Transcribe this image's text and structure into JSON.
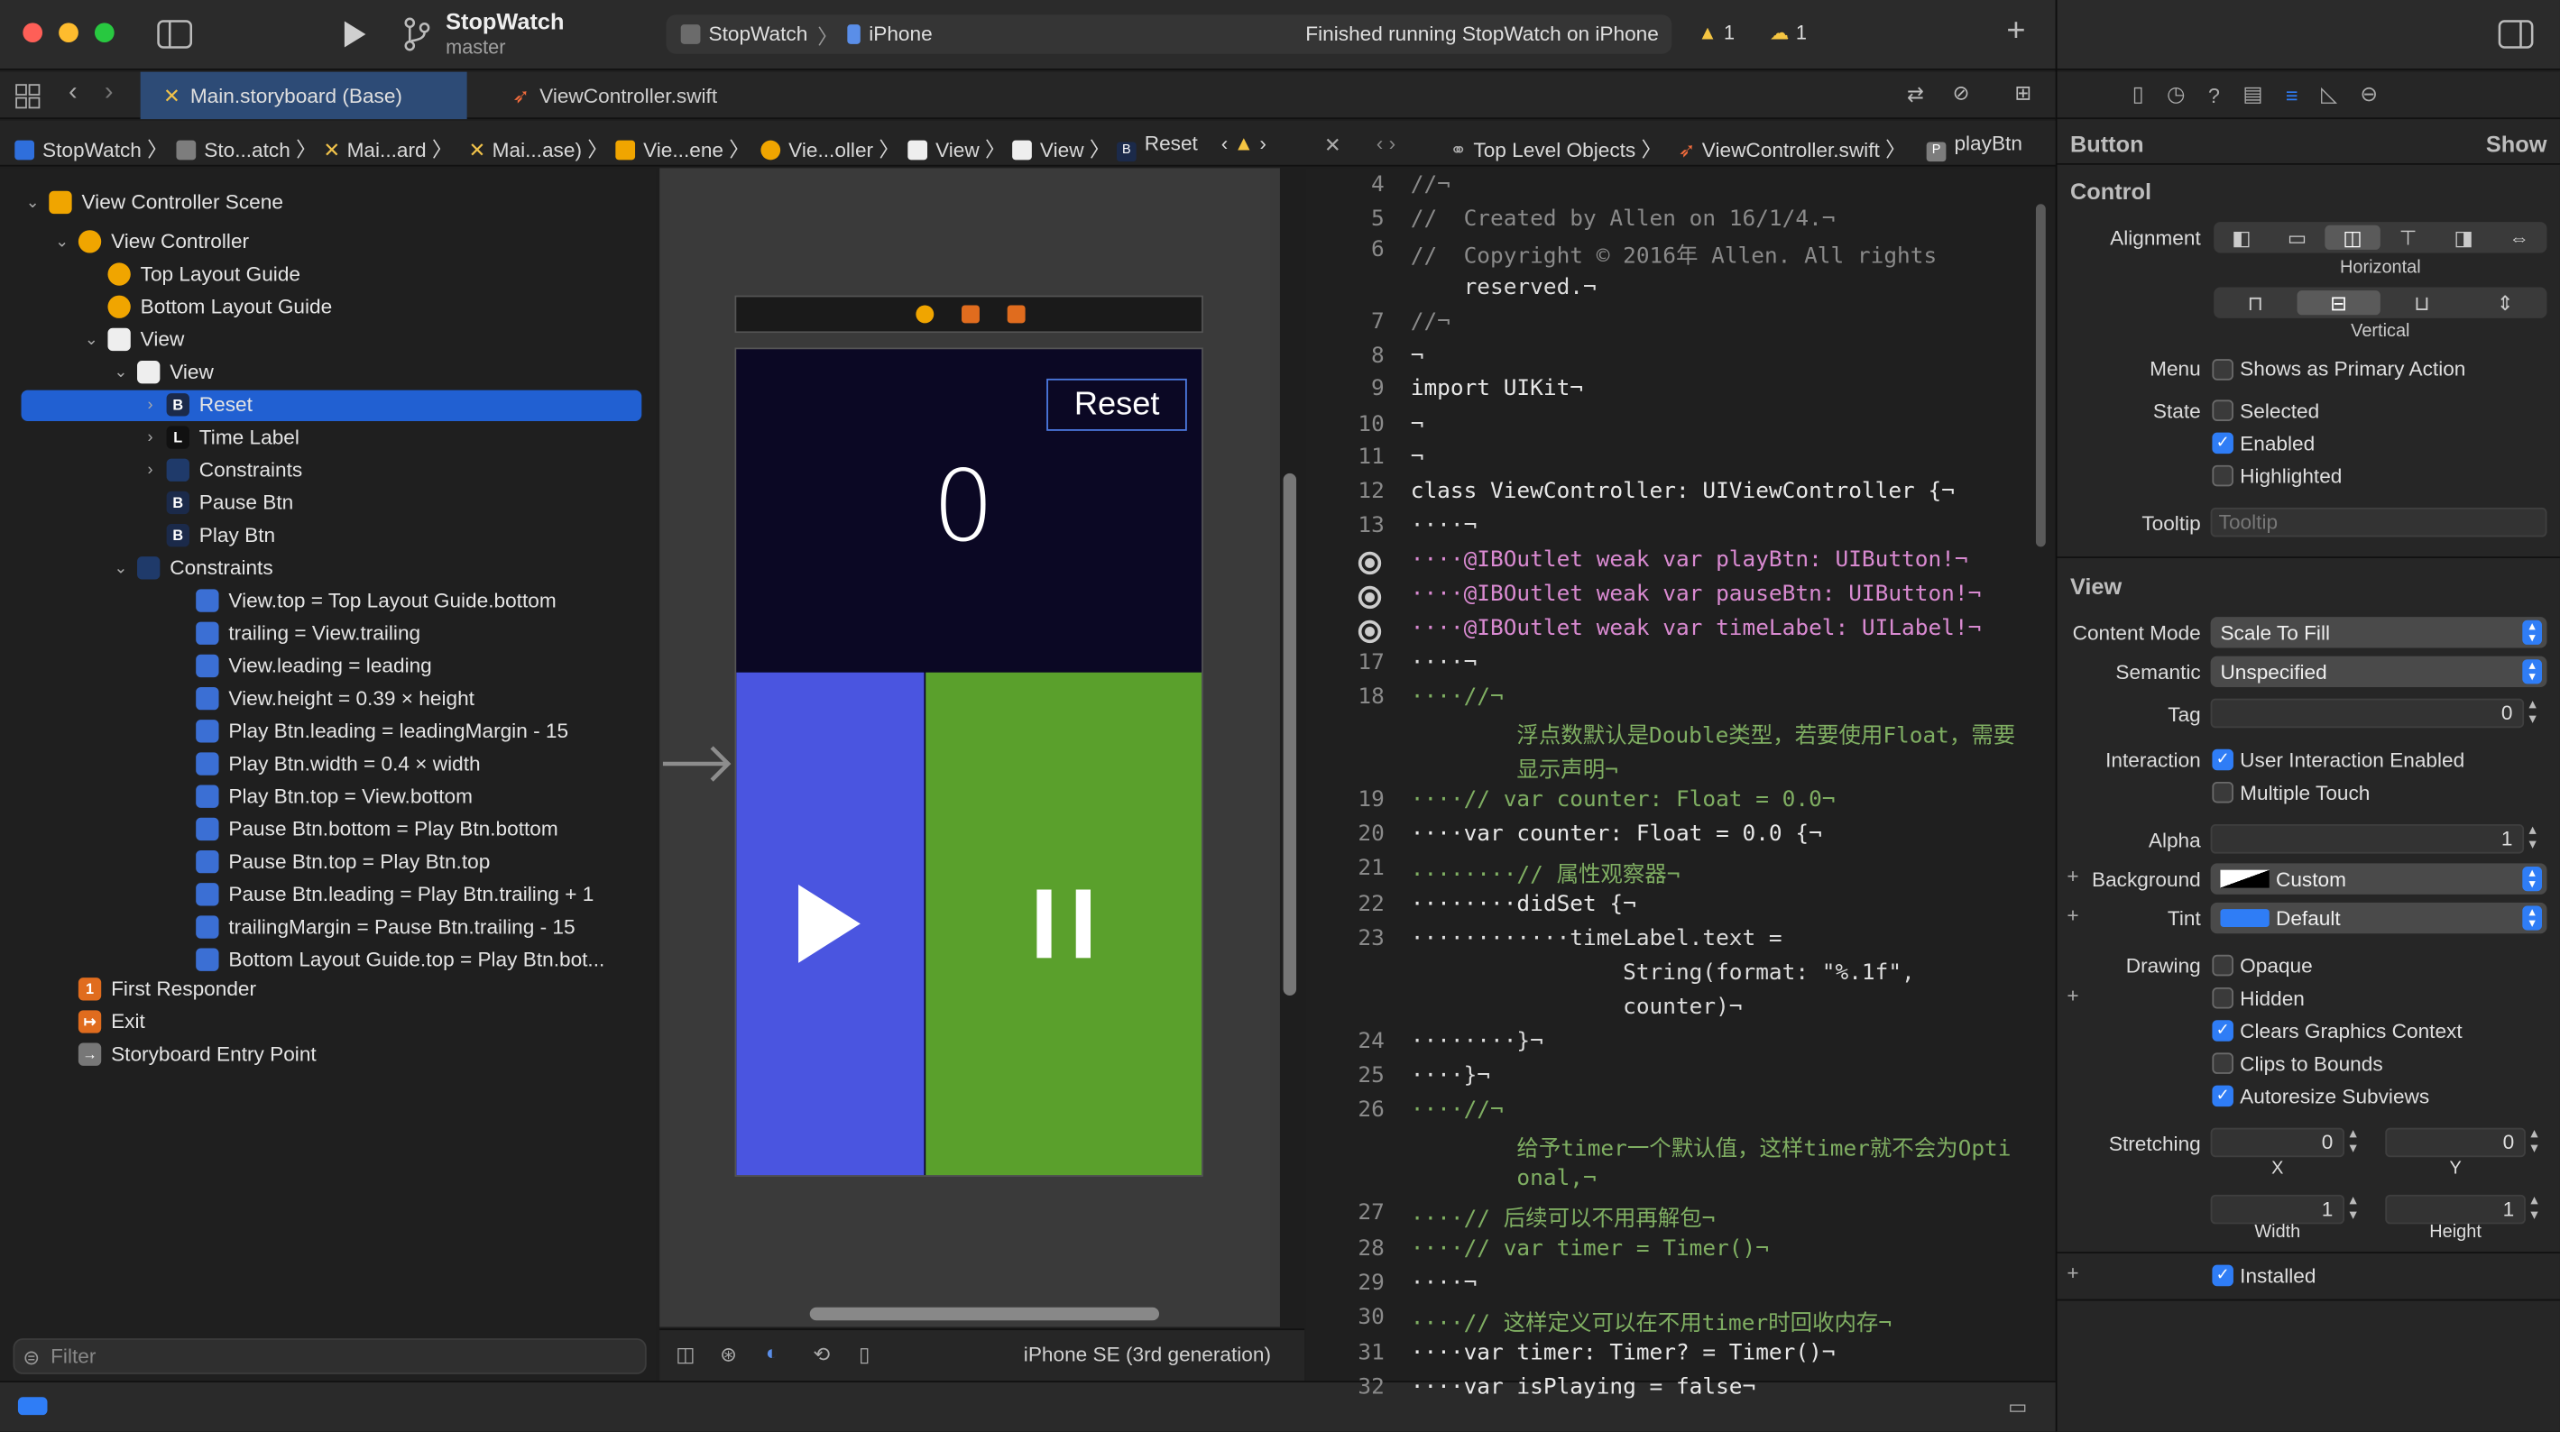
{
  "titlebar": {
    "project": "StopWatch",
    "branch": "master",
    "scheme": "StopWatch",
    "device": "iPhone",
    "status": "Finished running StopWatch on iPhone",
    "warnings": "1",
    "issues": "1"
  },
  "tabs": [
    {
      "label": "Main.storyboard (Base)"
    },
    {
      "label": "ViewController.swift"
    }
  ],
  "jumpbar": {
    "items": [
      "StopWatch",
      "Sto...atch",
      "Mai...ard",
      "Mai...ase)",
      "Vie...ene",
      "Vie...oller",
      "View",
      "View",
      "Reset"
    ],
    "right": [
      "Top Level Objects",
      "ViewController.swift",
      "playBtn"
    ]
  },
  "outline": {
    "items": [
      "View Controller Scene",
      "View Controller",
      "Top Layout Guide",
      "Bottom Layout Guide",
      "View",
      "View",
      "Reset",
      "Time Label",
      "Constraints",
      "Pause Btn",
      "Play Btn",
      "Constraints",
      "View.top = Top Layout Guide.bottom",
      "trailing = View.trailing",
      "View.leading = leading",
      "View.height = 0.39 × height",
      "Play Btn.leading = leadingMargin - 15",
      "Play Btn.width = 0.4 × width",
      "Play Btn.top = View.bottom",
      "Pause Btn.bottom = Play Btn.bottom",
      "Pause Btn.top = Play Btn.top",
      "Pause Btn.leading = Play Btn.trailing + 1",
      "trailingMargin = Pause Btn.trailing - 15",
      "Bottom Layout Guide.top = Play Btn.bot...",
      "First Responder",
      "Exit",
      "Storyboard Entry Point"
    ],
    "filter_placeholder": "Filter"
  },
  "canvas": {
    "reset_label": "Reset",
    "time_value": "0",
    "device_label": "iPhone SE (3rd generation)"
  },
  "code": {
    "lines": [
      {
        "n": "4",
        "t": "//¬"
      },
      {
        "n": "5",
        "t": "//  Created by Allen on 16/1/4.¬"
      },
      {
        "n": "6",
        "t": "//  Copyright © 2016年 Allen. All rights"
      },
      {
        "n": "",
        "t": "    reserved.¬"
      },
      {
        "n": "7",
        "t": "//¬"
      },
      {
        "n": "8",
        "t": "¬"
      },
      {
        "n": "9",
        "t": "import UIKit¬"
      },
      {
        "n": "10",
        "t": "¬"
      },
      {
        "n": "11",
        "t": "¬"
      },
      {
        "n": "12",
        "t": "class ViewController: UIViewController {¬"
      },
      {
        "n": "13",
        "t": "····¬"
      },
      {
        "n": "",
        "t": "····@IBOutlet weak var playBtn: UIButton!¬"
      },
      {
        "n": "",
        "t": "····@IBOutlet weak var pauseBtn: UIButton!¬"
      },
      {
        "n": "",
        "t": "····@IBOutlet weak var timeLabel: UILabel!¬"
      },
      {
        "n": "17",
        "t": "····¬"
      },
      {
        "n": "18",
        "t": "····//¬"
      },
      {
        "n": "",
        "t": "        浮点数默认是Double类型，若要使用Float，需要"
      },
      {
        "n": "",
        "t": "        显示声明¬"
      },
      {
        "n": "19",
        "t": "····// var counter: Float = 0.0¬"
      },
      {
        "n": "20",
        "t": "····var counter: Float = 0.0 {¬"
      },
      {
        "n": "21",
        "t": "········// 属性观察器¬"
      },
      {
        "n": "22",
        "t": "········didSet {¬"
      },
      {
        "n": "23",
        "t": "············timeLabel.text ="
      },
      {
        "n": "",
        "t": "                String(format: \"%.1f\","
      },
      {
        "n": "",
        "t": "                counter)¬"
      },
      {
        "n": "24",
        "t": "········}¬"
      },
      {
        "n": "25",
        "t": "····}¬"
      },
      {
        "n": "26",
        "t": "····//¬"
      },
      {
        "n": "",
        "t": "        给予timer一个默认值，这样timer就不会为Opti"
      },
      {
        "n": "",
        "t": "        onal,¬"
      },
      {
        "n": "27",
        "t": "····// 后续可以不用再解包¬"
      },
      {
        "n": "28",
        "t": "····// var timer = Timer()¬"
      },
      {
        "n": "29",
        "t": "····¬"
      },
      {
        "n": "30",
        "t": "····// 这样定义可以在不用timer时回收内存¬"
      },
      {
        "n": "31",
        "t": "····var timer: Timer? = Timer()¬"
      },
      {
        "n": "32",
        "t": "····var isPlaying = false¬"
      }
    ]
  },
  "inspector": {
    "title": "Button",
    "show": "Show",
    "control_hdr": "Control",
    "alignment": "Alignment",
    "horizontal": "Horizontal",
    "vertical": "Vertical",
    "menu": "Menu",
    "menu_opt": "Shows as Primary Action",
    "state": "State",
    "selected": "Selected",
    "enabled": "Enabled",
    "highlighted": "Highlighted",
    "tooltip": "Tooltip",
    "tooltip_ph": "Tooltip",
    "view_hdr": "View",
    "content_mode": "Content Mode",
    "content_mode_val": "Scale To Fill",
    "semantic": "Semantic",
    "semantic_val": "Unspecified",
    "tag": "Tag",
    "tag_val": "0",
    "interaction": "Interaction",
    "uie": "User Interaction Enabled",
    "mt": "Multiple Touch",
    "alpha": "Alpha",
    "alpha_val": "1",
    "background": "Background",
    "background_val": "Custom",
    "tint": "Tint",
    "tint_val": "Default",
    "drawing": "Drawing",
    "opaque": "Opaque",
    "hidden": "Hidden",
    "clears": "Clears Graphics Context",
    "clips": "Clips to Bounds",
    "autoresize": "Autoresize Subviews",
    "stretching": "Stretching",
    "x_val": "0",
    "y_val": "0",
    "x": "X",
    "y": "Y",
    "w_val": "1",
    "h_val": "1",
    "width": "Width",
    "height": "Height",
    "installed": "Installed"
  },
  "colors": {
    "accent": "#2f7df6",
    "play_bg": "#4a55e0",
    "pause_bg": "#5aa02c",
    "top_bg": "#0b0824"
  }
}
